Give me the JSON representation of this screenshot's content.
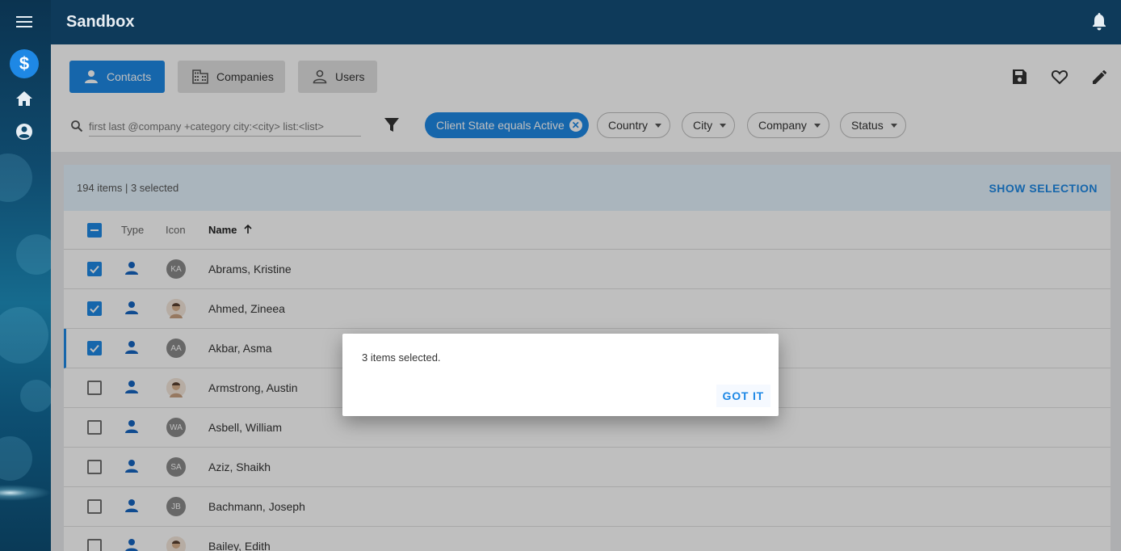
{
  "app": {
    "title": "Sandbox"
  },
  "rail": {
    "items": [
      "menu-icon",
      "dollar-icon",
      "home-icon",
      "account-icon"
    ],
    "active_label": "$"
  },
  "tabs": [
    {
      "label": "Contacts",
      "icon": "person-icon",
      "active": true
    },
    {
      "label": "Companies",
      "icon": "building-icon",
      "active": false
    },
    {
      "label": "Users",
      "icon": "person-outline-icon",
      "active": false
    }
  ],
  "actions": [
    "save-icon",
    "heart-icon",
    "pencil-icon"
  ],
  "search": {
    "placeholder": "first last @company +category city:<city> list:<list>"
  },
  "filters": {
    "active_chip": "Client State equals Active",
    "dropdowns": [
      "Country",
      "City",
      "Company",
      "Status"
    ]
  },
  "list": {
    "summary": "194 items | 3 selected",
    "show_selection": "SHOW SELECTION",
    "columns": {
      "type": "Type",
      "icon": "Icon",
      "name": "Name"
    },
    "rows": [
      {
        "name": "Abrams, Kristine",
        "initials": "KA",
        "selected": true,
        "photo": false
      },
      {
        "name": "Ahmed, Zineea",
        "initials": "",
        "selected": true,
        "photo": true
      },
      {
        "name": "Akbar, Asma",
        "initials": "AA",
        "selected": true,
        "photo": false
      },
      {
        "name": "Armstrong, Austin",
        "initials": "",
        "selected": false,
        "photo": true
      },
      {
        "name": "Asbell, William",
        "initials": "WA",
        "selected": false,
        "photo": false
      },
      {
        "name": "Aziz, Shaikh",
        "initials": "SA",
        "selected": false,
        "photo": false
      },
      {
        "name": "Bachmann, Joseph",
        "initials": "JB",
        "selected": false,
        "photo": false
      },
      {
        "name": "Bailey, Edith",
        "initials": "",
        "selected": false,
        "photo": true
      }
    ]
  },
  "dialog": {
    "message": "3 items selected.",
    "button": "GOT IT"
  },
  "colors": {
    "accent": "#1e88e5",
    "header": "#0e3a5a"
  }
}
